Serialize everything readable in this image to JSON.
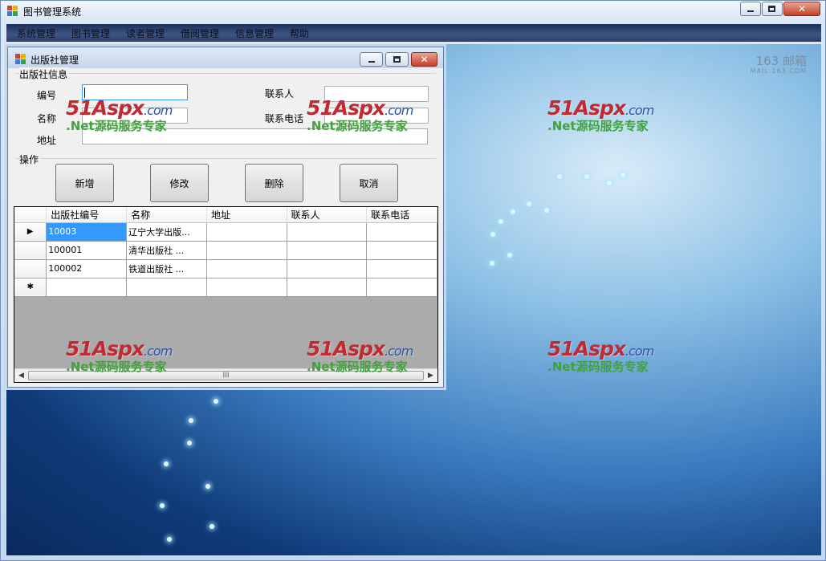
{
  "main_window": {
    "title": "图书管理系统",
    "menu": [
      "系统管理",
      "图书管理",
      "读者管理",
      "借阅管理",
      "信息管理",
      "帮助"
    ]
  },
  "desktop": {
    "mail_logo": "163 邮箱",
    "mail_logo_sub": "MAIL.163.COM"
  },
  "watermark": {
    "brand_top": "51Aspx",
    "brand_dot": ".com",
    "brand_bottom": ".Net源码服务专家"
  },
  "publisher_window": {
    "title": "出版社管理",
    "info_group": "出版社信息",
    "fields": {
      "id_label": "编号",
      "name_label": "名称",
      "address_label": "地址",
      "contact_label": "联系人",
      "phone_label": "联系电话",
      "id_value": "",
      "name_value": "",
      "address_value": "",
      "contact_value": "",
      "phone_value": ""
    },
    "ops_group": "操作",
    "buttons": {
      "add": "新增",
      "edit": "修改",
      "delete": "删除",
      "cancel": "取消"
    },
    "grid": {
      "columns": [
        "出版社编号",
        "名称",
        "地址",
        "联系人",
        "联系电话"
      ],
      "rows": [
        {
          "marker": "▶",
          "cells": [
            "10003",
            "辽宁大学出版...",
            "",
            "",
            ""
          ]
        },
        {
          "marker": "",
          "cells": [
            "100001",
            "清华出版社  ...",
            "",
            "",
            ""
          ]
        },
        {
          "marker": "",
          "cells": [
            "100002",
            "铁道出版社  ...",
            "",
            "",
            ""
          ]
        },
        {
          "marker": "✱",
          "cells": [
            "",
            "",
            "",
            "",
            ""
          ]
        }
      ],
      "scroll_grip": "III"
    }
  }
}
